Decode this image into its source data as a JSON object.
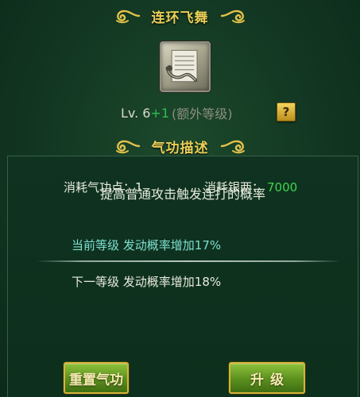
{
  "skill": {
    "title": "连环飞舞",
    "icon": "skill-scroll-icon"
  },
  "level": {
    "label": "Lv.",
    "value": "6",
    "bonus": "+1",
    "extra_label": "(额外等级)"
  },
  "help_button": {
    "label": "?"
  },
  "description": {
    "section_title": "气功描述",
    "text": "提高普通攻击触发连打的概率",
    "current_level": "当前等级  发动概率增加17%",
    "next_level": "下一等级  发动概率增加18%"
  },
  "cost": {
    "qigong_label": "消耗气功点：",
    "qigong_value": "1",
    "silver_label": "消耗银两：",
    "silver_value": "7000"
  },
  "buttons": {
    "reset": "重置气功",
    "upgrade": "升级"
  },
  "colors": {
    "title_gold": "#e9cf58",
    "bonus_green": "#2cbf50",
    "current_level_cyan": "#7ee0d0",
    "silver_value_green": "#3fd64d",
    "button_green": "#5a8f1f"
  }
}
